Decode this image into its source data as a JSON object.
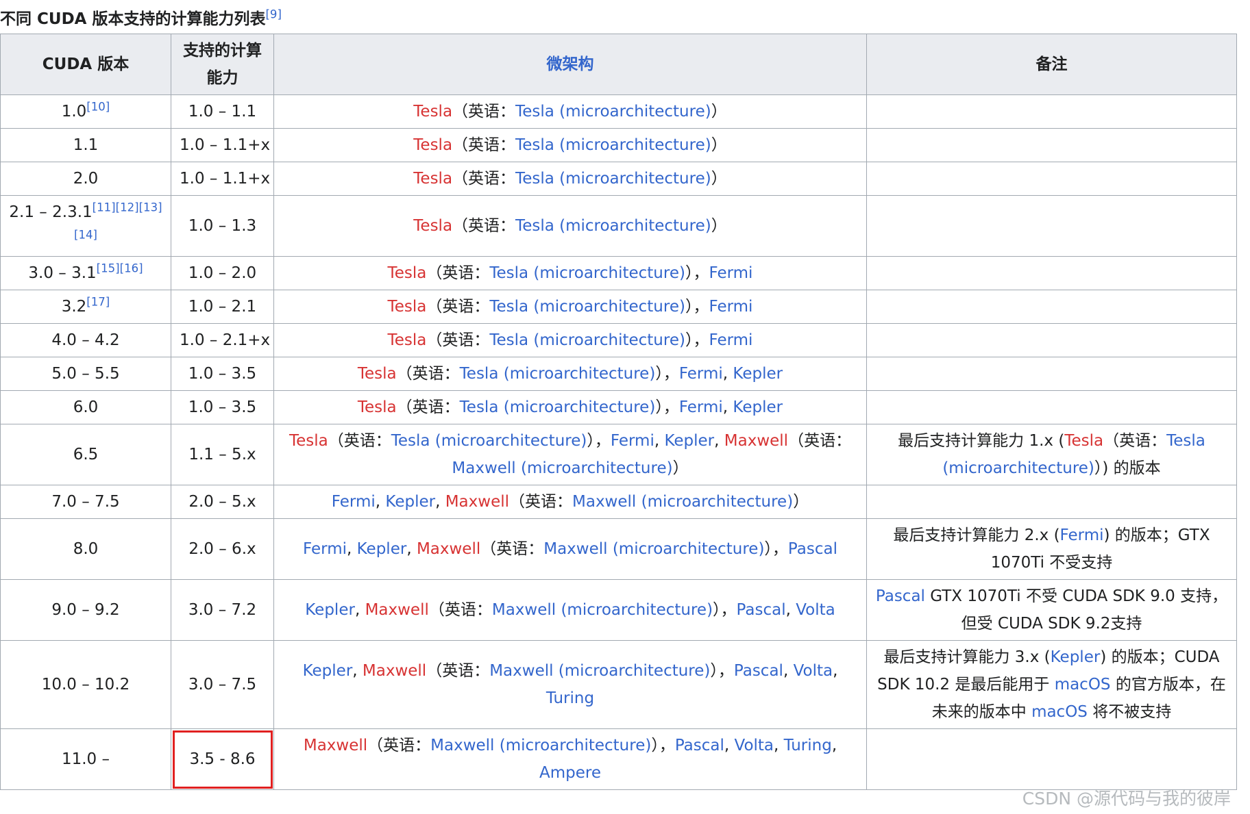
{
  "caption": {
    "text": "不同 CUDA 版本支持的计算能力列表",
    "ref": "[9]"
  },
  "headers": {
    "cuda_version": "CUDA 版本",
    "compute_capability": "支持的计算能力",
    "microarchitecture": "微架构",
    "notes": "备注"
  },
  "highlight_color": "#e02020",
  "link_color": "#3366cc",
  "redlink_color": "#d73333",
  "watermark": "CSDN @源代码与我的彼岸",
  "rows": [
    {
      "version": "1.0",
      "version_ref": "[10]",
      "cc": "1.0 – 1.1",
      "arch": [
        {
          "text": "Tesla",
          "style": "r"
        },
        {
          "text": "（英语：",
          "style": "t"
        },
        {
          "text": "Tesla (microarchitecture)",
          "style": "l"
        },
        {
          "text": "）",
          "style": "t"
        }
      ],
      "note": []
    },
    {
      "version": "1.1",
      "version_ref": "",
      "cc": "1.0 – 1.1+x",
      "arch": [
        {
          "text": "Tesla",
          "style": "r"
        },
        {
          "text": "（英语：",
          "style": "t"
        },
        {
          "text": "Tesla (microarchitecture)",
          "style": "l"
        },
        {
          "text": "）",
          "style": "t"
        }
      ],
      "note": []
    },
    {
      "version": "2.0",
      "version_ref": "",
      "cc": "1.0 – 1.1+x",
      "arch": [
        {
          "text": "Tesla",
          "style": "r"
        },
        {
          "text": "（英语：",
          "style": "t"
        },
        {
          "text": "Tesla (microarchitecture)",
          "style": "l"
        },
        {
          "text": "）",
          "style": "t"
        }
      ],
      "note": []
    },
    {
      "version": "2.1 – 2.3.1",
      "version_ref": "[11][12][13][14]",
      "cc": "1.0 – 1.3",
      "arch": [
        {
          "text": "Tesla",
          "style": "r"
        },
        {
          "text": "（英语：",
          "style": "t"
        },
        {
          "text": "Tesla (microarchitecture)",
          "style": "l"
        },
        {
          "text": "）",
          "style": "t"
        }
      ],
      "note": []
    },
    {
      "version": "3.0 – 3.1",
      "version_ref": "[15][16]",
      "cc": "1.0 – 2.0",
      "arch": [
        {
          "text": "Tesla",
          "style": "r"
        },
        {
          "text": "（英语：",
          "style": "t"
        },
        {
          "text": "Tesla (microarchitecture)",
          "style": "l"
        },
        {
          "text": "），",
          "style": "t"
        },
        {
          "text": "Fermi",
          "style": "l"
        }
      ],
      "note": []
    },
    {
      "version": "3.2",
      "version_ref": "[17]",
      "cc": "1.0 – 2.1",
      "arch": [
        {
          "text": "Tesla",
          "style": "r"
        },
        {
          "text": "（英语：",
          "style": "t"
        },
        {
          "text": "Tesla (microarchitecture)",
          "style": "l"
        },
        {
          "text": "），",
          "style": "t"
        },
        {
          "text": "Fermi",
          "style": "l"
        }
      ],
      "note": []
    },
    {
      "version": "4.0 – 4.2",
      "version_ref": "",
      "cc": "1.0 – 2.1+x",
      "arch": [
        {
          "text": "Tesla",
          "style": "r"
        },
        {
          "text": "（英语：",
          "style": "t"
        },
        {
          "text": "Tesla (microarchitecture)",
          "style": "l"
        },
        {
          "text": "），",
          "style": "t"
        },
        {
          "text": "Fermi",
          "style": "l"
        }
      ],
      "note": []
    },
    {
      "version": "5.0 – 5.5",
      "version_ref": "",
      "cc": "1.0 – 3.5",
      "arch": [
        {
          "text": "Tesla",
          "style": "r"
        },
        {
          "text": "（英语：",
          "style": "t"
        },
        {
          "text": "Tesla (microarchitecture)",
          "style": "l"
        },
        {
          "text": "），",
          "style": "t"
        },
        {
          "text": "Fermi",
          "style": "l"
        },
        {
          "text": ", ",
          "style": "t"
        },
        {
          "text": "Kepler",
          "style": "l"
        }
      ],
      "note": []
    },
    {
      "version": "6.0",
      "version_ref": "",
      "cc": "1.0 – 3.5",
      "arch": [
        {
          "text": "Tesla",
          "style": "r"
        },
        {
          "text": "（英语：",
          "style": "t"
        },
        {
          "text": "Tesla (microarchitecture)",
          "style": "l"
        },
        {
          "text": "），",
          "style": "t"
        },
        {
          "text": "Fermi",
          "style": "l"
        },
        {
          "text": ", ",
          "style": "t"
        },
        {
          "text": "Kepler",
          "style": "l"
        }
      ],
      "note": []
    },
    {
      "version": "6.5",
      "version_ref": "",
      "cc": "1.1 – 5.x",
      "arch": [
        {
          "text": "Tesla",
          "style": "r"
        },
        {
          "text": "（英语：",
          "style": "t"
        },
        {
          "text": "Tesla (microarchitecture)",
          "style": "l"
        },
        {
          "text": "），",
          "style": "t"
        },
        {
          "text": "Fermi",
          "style": "l"
        },
        {
          "text": ", ",
          "style": "t"
        },
        {
          "text": "Kepler",
          "style": "l"
        },
        {
          "text": ", ",
          "style": "t"
        },
        {
          "text": "Maxwell",
          "style": "r"
        },
        {
          "text": "（英语：",
          "style": "t"
        },
        {
          "text": "Maxwell (microarchitecture)",
          "style": "l"
        },
        {
          "text": "）",
          "style": "t"
        }
      ],
      "note": [
        {
          "text": "最后支持计算能力 1.x (",
          "style": "t"
        },
        {
          "text": "Tesla",
          "style": "r"
        },
        {
          "text": "（英语：",
          "style": "t"
        },
        {
          "text": "Tesla (microarchitecture)",
          "style": "l"
        },
        {
          "text": "）) 的版本",
          "style": "t"
        }
      ]
    },
    {
      "version": "7.0 – 7.5",
      "version_ref": "",
      "cc": "2.0 – 5.x",
      "arch": [
        {
          "text": "Fermi",
          "style": "l"
        },
        {
          "text": ", ",
          "style": "t"
        },
        {
          "text": "Kepler",
          "style": "l"
        },
        {
          "text": ", ",
          "style": "t"
        },
        {
          "text": "Maxwell",
          "style": "r"
        },
        {
          "text": "（英语：",
          "style": "t"
        },
        {
          "text": "Maxwell (microarchitecture)",
          "style": "l"
        },
        {
          "text": "）",
          "style": "t"
        }
      ],
      "note": []
    },
    {
      "version": "8.0",
      "version_ref": "",
      "cc": "2.0 – 6.x",
      "arch": [
        {
          "text": "Fermi",
          "style": "l"
        },
        {
          "text": ", ",
          "style": "t"
        },
        {
          "text": "Kepler",
          "style": "l"
        },
        {
          "text": ", ",
          "style": "t"
        },
        {
          "text": "Maxwell",
          "style": "r"
        },
        {
          "text": "（英语：",
          "style": "t"
        },
        {
          "text": "Maxwell (microarchitecture)",
          "style": "l"
        },
        {
          "text": "），",
          "style": "t"
        },
        {
          "text": "Pascal",
          "style": "l"
        }
      ],
      "note": [
        {
          "text": "最后支持计算能力 2.x (",
          "style": "t"
        },
        {
          "text": "Fermi",
          "style": "l"
        },
        {
          "text": ") 的版本；GTX 1070Ti 不受支持",
          "style": "t"
        }
      ]
    },
    {
      "version": "9.0 – 9.2",
      "version_ref": "",
      "cc": "3.0 – 7.2",
      "arch": [
        {
          "text": "Kepler",
          "style": "l"
        },
        {
          "text": ", ",
          "style": "t"
        },
        {
          "text": "Maxwell",
          "style": "r"
        },
        {
          "text": "（英语：",
          "style": "t"
        },
        {
          "text": "Maxwell (microarchitecture)",
          "style": "l"
        },
        {
          "text": "），",
          "style": "t"
        },
        {
          "text": "Pascal",
          "style": "l"
        },
        {
          "text": ", ",
          "style": "t"
        },
        {
          "text": "Volta",
          "style": "l"
        }
      ],
      "note": [
        {
          "text": "Pascal",
          "style": "l"
        },
        {
          "text": " GTX 1070Ti 不受 CUDA SDK 9.0 支持，但受 CUDA SDK 9.2支持",
          "style": "t"
        }
      ]
    },
    {
      "version": "10.0 – 10.2",
      "version_ref": "",
      "cc": "3.0 – 7.5",
      "arch": [
        {
          "text": "Kepler",
          "style": "l"
        },
        {
          "text": ", ",
          "style": "t"
        },
        {
          "text": "Maxwell",
          "style": "r"
        },
        {
          "text": "（英语：",
          "style": "t"
        },
        {
          "text": "Maxwell (microarchitecture)",
          "style": "l"
        },
        {
          "text": "），",
          "style": "t"
        },
        {
          "text": "Pascal",
          "style": "l"
        },
        {
          "text": ", ",
          "style": "t"
        },
        {
          "text": "Volta",
          "style": "l"
        },
        {
          "text": ", ",
          "style": "t"
        },
        {
          "text": "Turing",
          "style": "l"
        }
      ],
      "note": [
        {
          "text": "最后支持计算能力 3.x (",
          "style": "t"
        },
        {
          "text": "Kepler",
          "style": "l"
        },
        {
          "text": ") 的版本；CUDA SDK 10.2 是最后能用于 ",
          "style": "t"
        },
        {
          "text": "macOS",
          "style": "l"
        },
        {
          "text": " 的官方版本，在未来的版本中 ",
          "style": "t"
        },
        {
          "text": "macOS",
          "style": "l"
        },
        {
          "text": " 将不被支持",
          "style": "t"
        }
      ]
    },
    {
      "version": "11.0 –",
      "version_ref": "",
      "cc": "3.5 - 8.6",
      "highlight_cc": true,
      "arch": [
        {
          "text": "Maxwell",
          "style": "r"
        },
        {
          "text": "（英语：",
          "style": "t"
        },
        {
          "text": "Maxwell (microarchitecture)",
          "style": "l"
        },
        {
          "text": "），",
          "style": "t"
        },
        {
          "text": "Pascal",
          "style": "l"
        },
        {
          "text": ", ",
          "style": "t"
        },
        {
          "text": "Volta",
          "style": "l"
        },
        {
          "text": ", ",
          "style": "t"
        },
        {
          "text": "Turing",
          "style": "l"
        },
        {
          "text": ", ",
          "style": "t"
        },
        {
          "text": "Ampere",
          "style": "l"
        }
      ],
      "note": []
    }
  ]
}
